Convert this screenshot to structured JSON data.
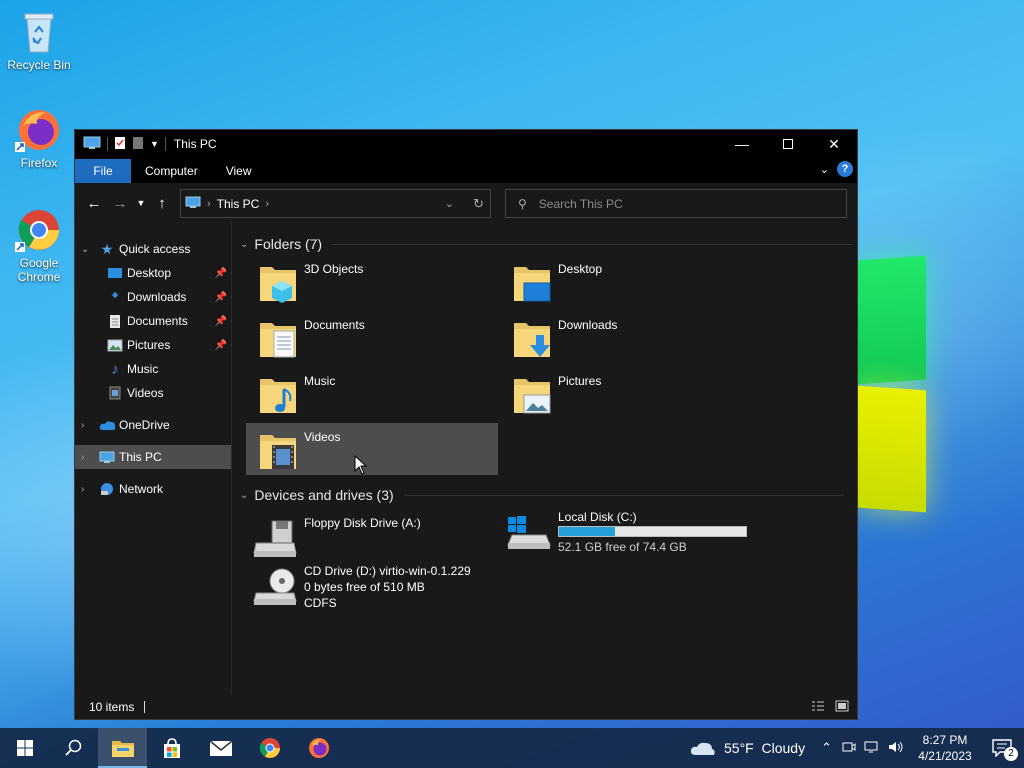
{
  "desktop": {
    "icons": [
      {
        "label": "Recycle Bin"
      },
      {
        "label": "Firefox"
      },
      {
        "label": "Google Chrome"
      }
    ]
  },
  "window": {
    "title": "This PC",
    "ribbon_tabs": [
      "File",
      "Computer",
      "View"
    ],
    "help_label": "?",
    "address": {
      "crumb": "This PC"
    },
    "search": {
      "placeholder": "Search This PC"
    }
  },
  "sidebar": {
    "quick_access": "Quick access",
    "pinned": [
      "Desktop",
      "Downloads",
      "Documents",
      "Pictures"
    ],
    "unpinned": [
      "Music",
      "Videos"
    ],
    "onedrive": "OneDrive",
    "this_pc": "This PC",
    "network": "Network"
  },
  "content": {
    "folders_header": "Folders (7)",
    "folders": [
      "3D Objects",
      "Desktop",
      "Documents",
      "Downloads",
      "Music",
      "Pictures",
      "Videos"
    ],
    "devices_header": "Devices and drives (3)",
    "drives": {
      "floppy": {
        "label": "Floppy Disk Drive (A:)"
      },
      "local": {
        "label": "Local Disk (C:)",
        "free_text": "52.1 GB free of 74.4 GB",
        "used_fraction": 0.3
      },
      "cd": {
        "label": "CD Drive (D:) virtio-win-0.1.229",
        "free_text": "0 bytes free of 510 MB",
        "fs": "CDFS"
      }
    }
  },
  "status": {
    "items": "10 items"
  },
  "taskbar": {
    "weather": "55°F  Cloudy",
    "time": "8:27 PM",
    "date": "4/21/2023",
    "notifications": "2"
  }
}
